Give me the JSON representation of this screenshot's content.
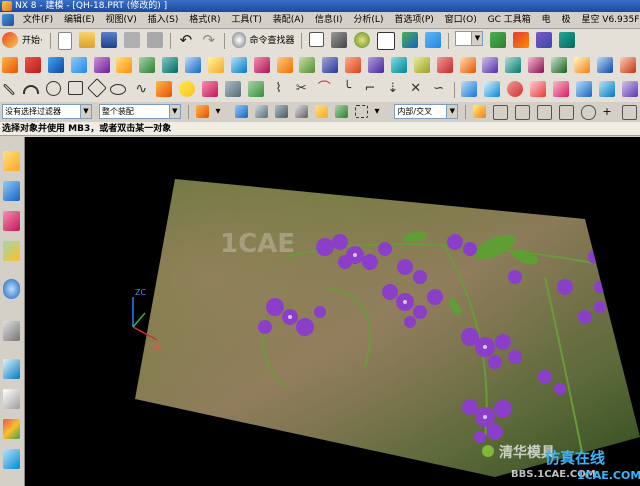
{
  "window": {
    "title": "NX 8 - 建模 - [QH-18.PRT  (修改的) ]"
  },
  "menubar": {
    "items": [
      "文件(F)",
      "编辑(E)",
      "视图(V)",
      "插入(S)",
      "格式(R)",
      "工具(T)",
      "装配(A)",
      "信息(I)",
      "分析(L)",
      "首选项(P)",
      "窗口(O)",
      "GC 工具箱",
      "电",
      "极",
      "星空 V6.935F"
    ]
  },
  "toolbar1": {
    "start_label": "开始·",
    "finder_label": "命令查找器"
  },
  "toolbar4": {
    "filter_value": "没有选择过滤器",
    "scope_value": "整个装配",
    "intersect_value": "内部/交叉"
  },
  "cue_line": "选择对象并使用 MB3，或者双击某一对象",
  "viewport": {
    "watermark_1cae": "1CAE",
    "watermark_site": "1CAE.COM",
    "watermark_bbs": "BBS.1CAE.COM",
    "watermark_cn": "清华模具",
    "watermark_wechat": "仿真在线",
    "wcs_x": "XC",
    "wcs_z": "ZC"
  },
  "colors": {
    "title_bg": "#1b4aa0",
    "toolbar_bg": "#e4e0d8",
    "viewport_bg": "#000000",
    "flower": "#8b3fc8"
  }
}
